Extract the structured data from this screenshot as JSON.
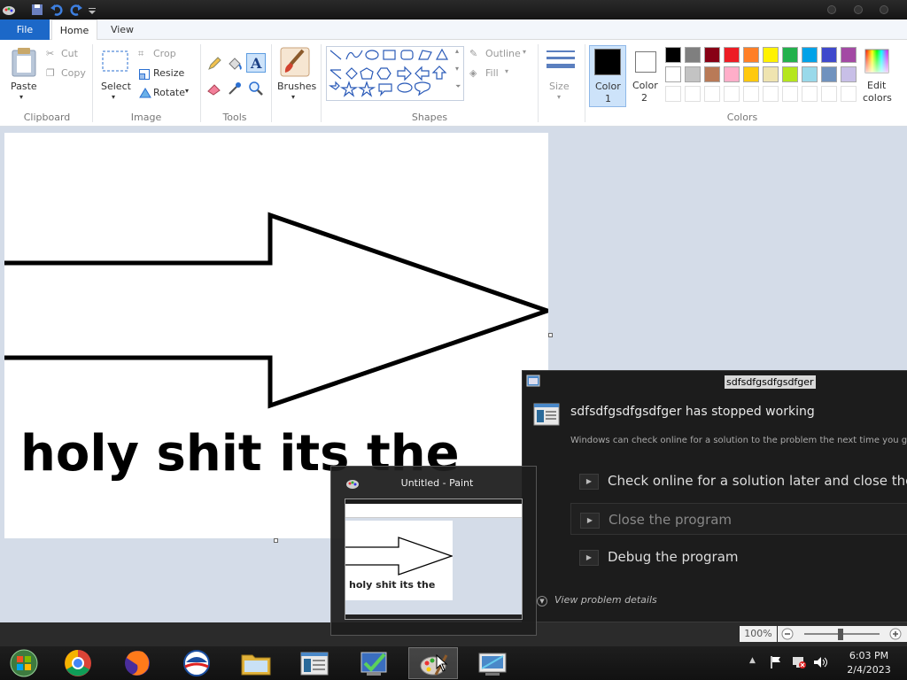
{
  "window": {
    "title": "Untitled - Paint"
  },
  "ribbon": {
    "tabs": {
      "file": "File",
      "home": "Home",
      "view": "View"
    },
    "clipboard": {
      "paste": "Paste",
      "cut": "Cut",
      "copy": "Copy",
      "label": "Clipboard"
    },
    "image": {
      "select": "Select",
      "crop": "Crop",
      "resize": "Resize",
      "rotate": "Rotate",
      "label": "Image"
    },
    "tools": {
      "label": "Tools"
    },
    "brushes": {
      "label": "Brushes"
    },
    "shapes": {
      "outline": "Outline",
      "fill": "Fill",
      "label": "Shapes"
    },
    "size": {
      "label": "Size"
    },
    "colors": {
      "color1_line1": "Color",
      "color1_line2": "1",
      "color2_line1": "Color",
      "color2_line2": "2",
      "edit_line1": "Edit",
      "edit_line2": "colors",
      "label": "Colors",
      "palette_row1": [
        "#000000",
        "#7f7f7f",
        "#880015",
        "#ed1c24",
        "#ff7f27",
        "#fff200",
        "#22b14c",
        "#00a2e8",
        "#3f48cc",
        "#a349a4"
      ],
      "palette_row2": [
        "#ffffff",
        "#c3c3c3",
        "#b97a57",
        "#ffaec9",
        "#ffc90e",
        "#efe4b0",
        "#b5e61d",
        "#99d9ea",
        "#7092be",
        "#c8bfe7"
      ],
      "color1": "#000000",
      "color2": "#ffffff"
    }
  },
  "canvas": {
    "text": "holy shit its the"
  },
  "dialog": {
    "title": "sdfsdfgsdfgsdfger",
    "heading": "sdfsdfgsdfgsdfger has stopped working",
    "subtext": "Windows can check online for a solution to the problem the next time you g",
    "options": [
      "Check online for a solution later and close the",
      "Close the program",
      "Debug the program"
    ],
    "details": "View problem details"
  },
  "preview": {
    "title": "Untitled - Paint",
    "text": "holy shit its the"
  },
  "statusbar": {
    "zoom": "100%"
  },
  "taskbar": {
    "time": "6:03 PM",
    "date": "2/4/2023"
  }
}
